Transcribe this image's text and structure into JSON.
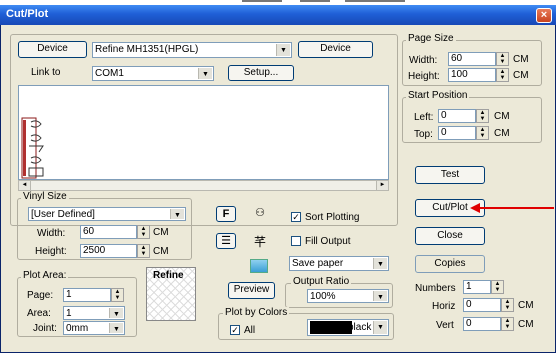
{
  "window": {
    "title": "Cut/Plot",
    "close": "×"
  },
  "device": {
    "left_button": "Device",
    "selected": "Refine MH1351(HPGL)",
    "right_button": "Device",
    "link_label": "Link to",
    "port": "COM1",
    "setup_button": "Setup..."
  },
  "page_size": {
    "title": "Page Size",
    "width_label": "Width:",
    "width": "60",
    "height_label": "Height:",
    "height": "100",
    "unit": "CM"
  },
  "start_position": {
    "title": "Start Position",
    "left_label": "Left:",
    "left": "0",
    "top_label": "Top:",
    "top": "0",
    "unit": "CM"
  },
  "vinyl": {
    "title": "Vinyl Size",
    "preset": "[User Defined]",
    "width_label": "Width:",
    "width": "60",
    "height_label": "Height:",
    "height": "2500",
    "unit": "CM"
  },
  "options": {
    "sort_plotting": "Sort Plotting",
    "fill_output": "Fill Output",
    "paper_mode": "Save paper",
    "icon_f": "F",
    "output_ratio_title": "Output Ratio",
    "output_ratio": "100%",
    "preview_button": "Preview"
  },
  "plot_area": {
    "title": "Plot Area:",
    "page_label": "Page:",
    "page": "1",
    "area_label": "Area:",
    "area": "1",
    "joint_label": "Joint:",
    "joint": "0mm"
  },
  "thumbnail": {
    "text": "Refine"
  },
  "plot_by_colors": {
    "title": "Plot by Colors",
    "all_label": "All",
    "color_name": "black"
  },
  "actions": {
    "test": "Test",
    "cutplot": "Cut/Plot",
    "close": "Close",
    "copies": "Copies"
  },
  "copies": {
    "numbers_label": "Numbers",
    "numbers": "1",
    "horiz_label": "Horiz",
    "horiz": "0",
    "vert_label": "Vert",
    "vert": "0",
    "unit": "CM"
  },
  "colors": {
    "title_bar": "#1f5fd6",
    "face": "#ece9d8",
    "arrow": "#e00000"
  }
}
